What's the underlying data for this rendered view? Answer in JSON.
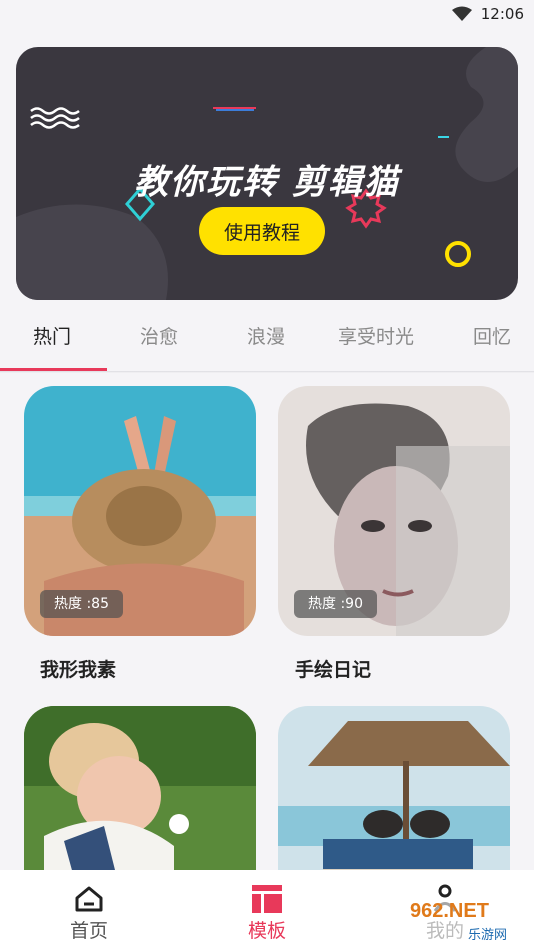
{
  "status_bar": {
    "time": "12:06"
  },
  "banner": {
    "title": "教你玩转 剪辑猫",
    "button_label": "使用教程"
  },
  "tabs": [
    {
      "label": "热门",
      "active": true
    },
    {
      "label": "治愈"
    },
    {
      "label": "浪漫"
    },
    {
      "label": "享受时光"
    },
    {
      "label": "回忆"
    }
  ],
  "cards": [
    {
      "title": "我形我素",
      "heat": "热度 :85"
    },
    {
      "title": "手绘日记",
      "heat": "热度 :90"
    },
    {
      "title": "",
      "heat": ""
    },
    {
      "title": "",
      "heat": ""
    }
  ],
  "bottom_nav": [
    {
      "label": "首页",
      "icon": "home-icon"
    },
    {
      "label": "模板",
      "icon": "template-icon",
      "active": true
    },
    {
      "label": "我的",
      "icon": "profile-icon"
    }
  ],
  "watermark": {
    "text": "962.NET",
    "subtext": "乐游网"
  },
  "colors": {
    "accent": "#e8395a",
    "banner_bg": "#3a373f",
    "button_yellow": "#ffe100"
  }
}
